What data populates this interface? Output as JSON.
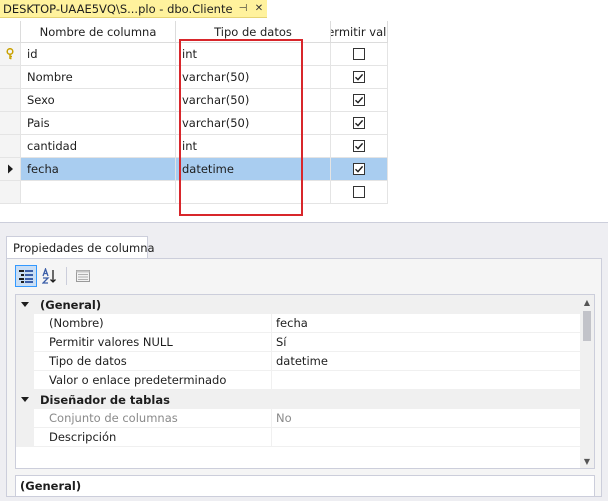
{
  "document_tab": {
    "title": "DESKTOP-UAAE5VQ\\S...plo - dbo.Cliente",
    "pin_glyph": "⊣",
    "close_glyph": "✕"
  },
  "grid": {
    "headers": [
      "Nombre de columna",
      "Tipo de datos",
      "Permitir val..."
    ],
    "rows": [
      {
        "name": "id",
        "type": "int",
        "allow_null": false,
        "primary_key": true,
        "selected": false
      },
      {
        "name": "Nombre",
        "type": "varchar(50)",
        "allow_null": true,
        "primary_key": false,
        "selected": false
      },
      {
        "name": "Sexo",
        "type": "varchar(50)",
        "allow_null": true,
        "primary_key": false,
        "selected": false
      },
      {
        "name": "Pais",
        "type": "varchar(50)",
        "allow_null": true,
        "primary_key": false,
        "selected": false
      },
      {
        "name": "cantidad",
        "type": "int",
        "allow_null": true,
        "primary_key": false,
        "selected": false
      },
      {
        "name": "fecha",
        "type": "datetime",
        "allow_null": true,
        "primary_key": false,
        "selected": true
      },
      {
        "name": "",
        "type": "",
        "allow_null": false,
        "primary_key": false,
        "selected": false
      }
    ],
    "highlight_color": "#d8262b",
    "selection_color": "#a9cdf0"
  },
  "properties": {
    "tab_label": "Propiedades de columna",
    "toolbar_icons": [
      "categorized-icon",
      "alphabetical-icon",
      "property-pages-icon"
    ],
    "items": [
      {
        "kind": "category",
        "label": "(General)"
      },
      {
        "kind": "prop",
        "name": "(Nombre)",
        "value": "fecha",
        "disabled": false
      },
      {
        "kind": "prop",
        "name": "Permitir valores NULL",
        "value": "Sí",
        "disabled": false
      },
      {
        "kind": "prop",
        "name": "Tipo de datos",
        "value": "datetime",
        "disabled": false
      },
      {
        "kind": "prop",
        "name": "Valor o enlace predeterminado",
        "value": "",
        "disabled": false
      },
      {
        "kind": "category",
        "label": "Diseñador de tablas"
      },
      {
        "kind": "prop",
        "name": "Conjunto de columnas",
        "value": "No",
        "disabled": true
      },
      {
        "kind": "prop",
        "name": "Descripción",
        "value": "",
        "disabled": false
      }
    ],
    "description_title": "(General)",
    "scroll_up_glyph": "▲",
    "scroll_down_glyph": "▼"
  }
}
